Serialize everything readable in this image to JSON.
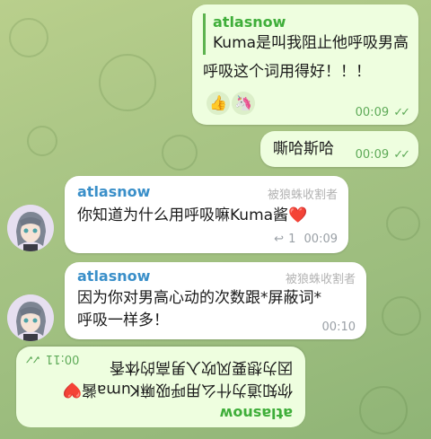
{
  "messages": {
    "m1": {
      "reply_name": "atlasnow",
      "reply_text_line1": "Kuma是叫我阻止他呼吸男高",
      "reply_text_line2": "呼吸这个词用得好！！！",
      "reactions": [
        "👍",
        "🦄"
      ],
      "time": "00:09"
    },
    "m2": {
      "text": "嘶哈斯哈",
      "time": "00:09"
    },
    "m3": {
      "sender": "atlasnow",
      "role": "被狼蛛收割者",
      "text": "你知道为什么用呼吸嘛Kuma酱❤️",
      "replies": "1",
      "time": "00:09"
    },
    "m4": {
      "sender": "atlasnow",
      "role": "被狼蛛收割者",
      "text_line1": "因为你对男高心动的次数跟*屏蔽词*",
      "text_line2": "呼吸一样多！",
      "time": "00:10"
    },
    "m5": {
      "sender": "atlasnow",
      "text_line1": "你知道为什么用呼吸嘛Kuma酱❤️",
      "text_line2": "因为想要风吹入男高的体香",
      "time": "00:11"
    }
  },
  "icons": {
    "check": "double-check-icon",
    "reply": "reply-arrow-icon"
  },
  "colors": {
    "outgoing_bubble": "#eefedf",
    "incoming_bubble": "#ffffff",
    "sender_name": "#3a8fc9",
    "time_green": "#5eaa58"
  }
}
